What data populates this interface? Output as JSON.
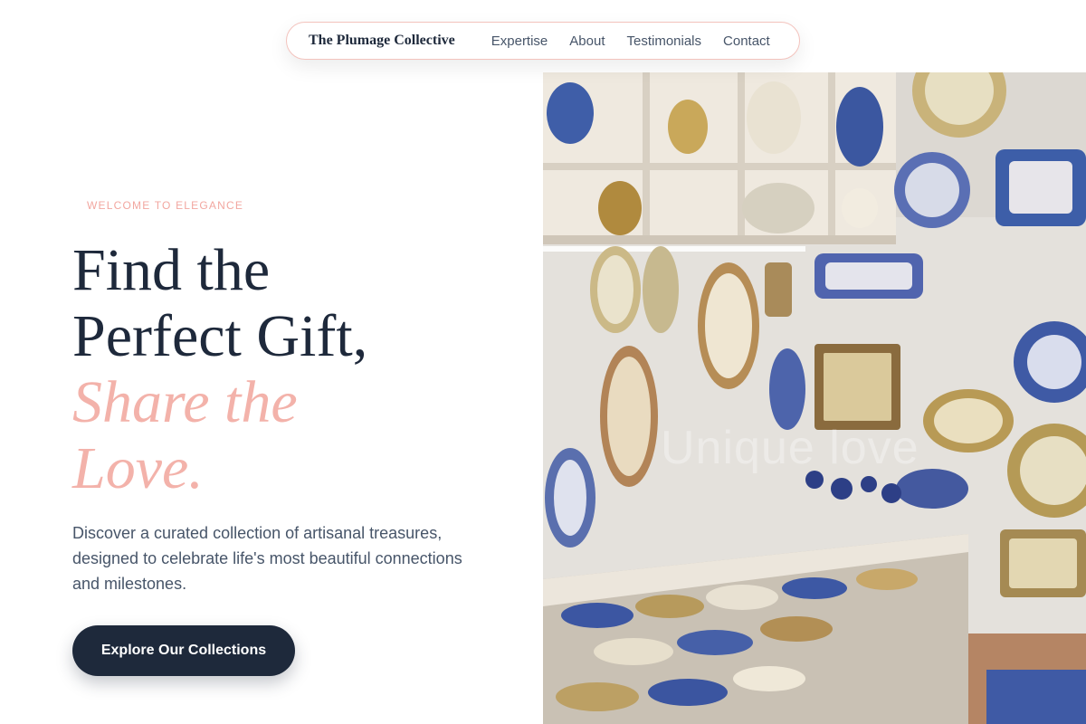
{
  "nav": {
    "brand": "The Plumage Collective",
    "links": [
      "Expertise",
      "About",
      "Testimonials",
      "Contact"
    ]
  },
  "hero": {
    "eyebrow": "WELCOME TO ELEGANCE",
    "headline_lines": [
      "Find the",
      "Perfect Gift,"
    ],
    "headline_accent_lines": [
      "Share the",
      "Love."
    ],
    "description": "Discover a curated collection of artisanal treasures, designed to celebrate life's most beautiful connections and milestones.",
    "cta_label": "Explore Our Collections"
  },
  "image": {
    "subject": "shop wall displaying hand-painted ceramic plates, tiles and pottery on white shelves",
    "watermark": "Unique love"
  },
  "colors": {
    "navy": "#1e293b",
    "accent_pink": "#f3b2aa",
    "body_text": "#475569",
    "nav_border": "#f3c3bd"
  }
}
